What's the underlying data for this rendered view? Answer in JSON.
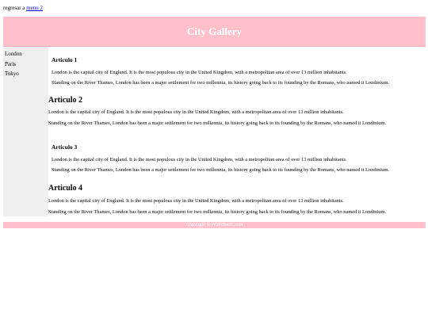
{
  "nav": {
    "prefix": "regresar a",
    "link": "menu 2"
  },
  "header": {
    "title": "City Gallery"
  },
  "sidebar": {
    "items": [
      {
        "label": "London"
      },
      {
        "label": "Paris"
      },
      {
        "label": "Tokyo"
      }
    ]
  },
  "articles": [
    {
      "title": "Articulo 1",
      "p1": "London is the capital city of England. It is the most populous city in the United Kingdom, with a metropolitan area of over 13 million inhabitants.",
      "p2": "Standing on the River Thames, London has been a major settlement for two millennia, its history going back to its founding by the Romans, who named it Londinium."
    },
    {
      "title": "Articulo 2",
      "p1": "London is the capital city of England. It is the most populous city in the United Kingdom, with a metropolitan area of over 13 million inhabitants.",
      "p2": "Standing on the River Thames, London has been a major settlement for two millennia, its history going back to its founding by the Romans, who named it Londinium."
    },
    {
      "title": "Articulo 3",
      "p1": "London is the capital city of England. It is the most populous city in the United Kingdom, with a metropolitan area of over 13 million inhabitants.",
      "p2": "Standing on the River Thames, London has been a major settlement for two millennia, its history going back to its founding by the Romans, who named it Londinium."
    },
    {
      "title": "Articulo 4",
      "p1": "London is the capital city of England. It is the most populous city in the United Kingdom, with a metropolitan area of over 13 million inhabitants.",
      "p2": "Standing on the River Thames, London has been a major settlement for two millennia, its history going back to its founding by the Romans, who named it Londinium."
    }
  ],
  "footer": {
    "text": "Copyright © W3Schools.com"
  },
  "colors": {
    "header_bg": "#ffc0cb",
    "sidebar_bg": "#efefef",
    "link": "#0000ee"
  }
}
